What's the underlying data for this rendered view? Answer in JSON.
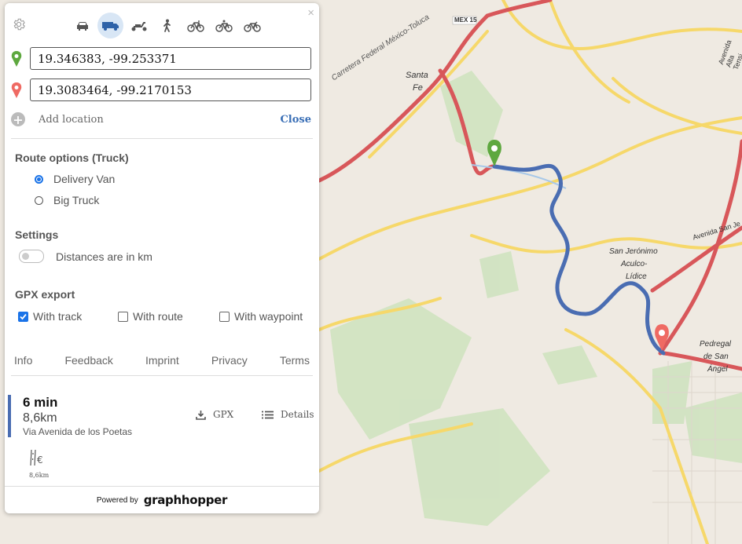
{
  "map": {
    "labels": [
      {
        "text": "Carretera Federal México-Toluca",
        "name": "road-label-toluca"
      },
      {
        "text": "Santa",
        "name": "place-label-santa"
      },
      {
        "text": "Fe",
        "name": "place-label-fe"
      },
      {
        "text": "MEX 15",
        "name": "road-shield-mex15"
      },
      {
        "text": "San Jerónimo",
        "name": "place-label-san-jeronimo"
      },
      {
        "text": "Aculco-",
        "name": "place-label-aculco"
      },
      {
        "text": "Lídice",
        "name": "place-label-lidice"
      },
      {
        "text": "Pedregal",
        "name": "place-label-pedregal"
      },
      {
        "text": "de San",
        "name": "place-label-de-san"
      },
      {
        "text": "Ángel",
        "name": "place-label-angel"
      },
      {
        "text": "Avenida San Je",
        "name": "road-label-avenida-san-je"
      },
      {
        "text": "Avenida Alta Tensi",
        "name": "road-label-alta-tension"
      }
    ],
    "colors": {
      "route": "#4a6db2",
      "start_pin": "#5ea83f",
      "end_pin": "#ef6a63",
      "highway": "#d8575a",
      "primary_road": "#f6d86a"
    }
  },
  "panel": {
    "close_symbol": "×",
    "settings_icon": "gear-icon",
    "modes": [
      {
        "name": "car",
        "active": false
      },
      {
        "name": "truck",
        "active": true
      },
      {
        "name": "scooter",
        "active": false
      },
      {
        "name": "foot",
        "active": false
      },
      {
        "name": "bike",
        "active": false
      },
      {
        "name": "mtb",
        "active": false
      },
      {
        "name": "racingbike",
        "active": false
      }
    ],
    "start_value": "19.346383, -99.253371",
    "end_value": "19.3083464, -99.2170153",
    "add_location": "Add location",
    "close_label": "Close",
    "route_options": {
      "title": "Route options (Truck)",
      "options": [
        {
          "label": "Delivery Van",
          "checked": true
        },
        {
          "label": "Big Truck",
          "checked": false
        }
      ]
    },
    "settings": {
      "title": "Settings",
      "distances_label": "Distances are in km"
    },
    "gpx": {
      "title": "GPX export",
      "with_track": "With track",
      "with_route": "With route",
      "with_waypoint": "With waypoint"
    },
    "links": {
      "info": "Info",
      "feedback": "Feedback",
      "imprint": "Imprint",
      "privacy": "Privacy",
      "terms": "Terms"
    },
    "route": {
      "time": "6 min",
      "distance": "8,6km",
      "via": "Via Avenida de los Poetas",
      "gpx_label": "GPX",
      "details_label": "Details",
      "toll_distance": "8,6km"
    },
    "footer": {
      "powered_by": "Powered by",
      "logo_text": "graphhopper"
    }
  }
}
